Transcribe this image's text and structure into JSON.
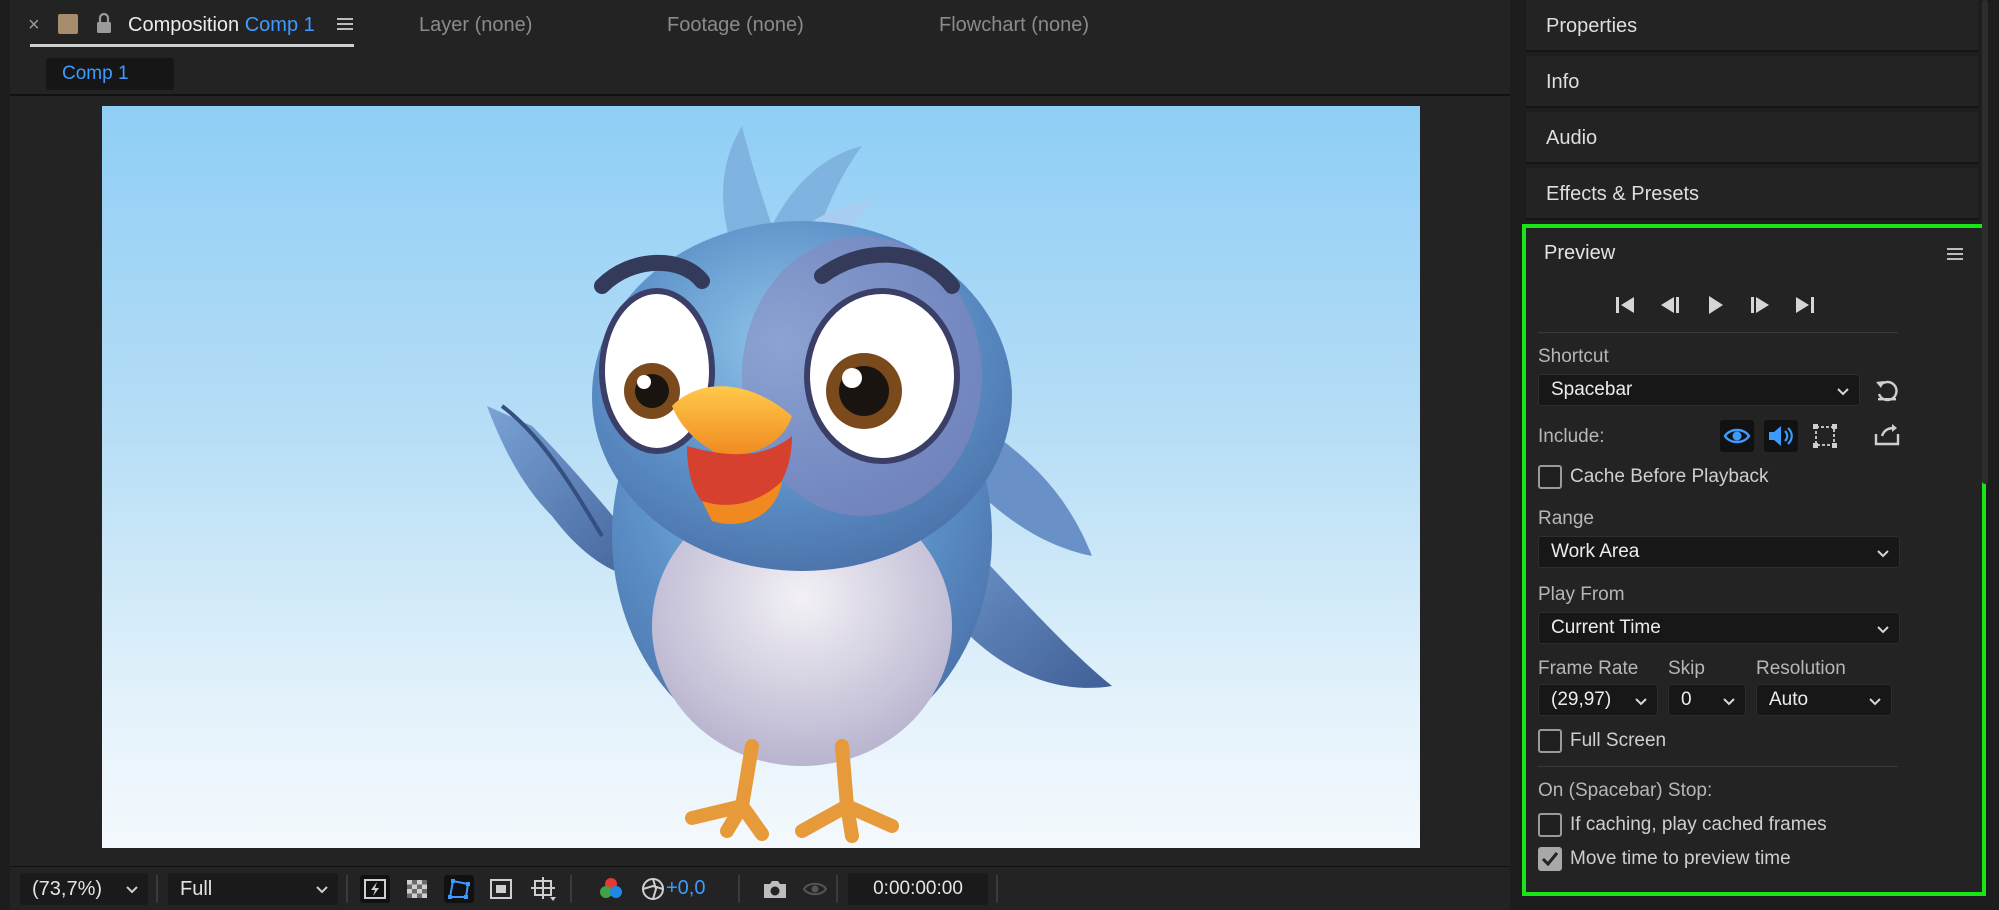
{
  "composition_tab": {
    "close_glyph": "×",
    "title_prefix": "Composition",
    "title_name": "Comp 1",
    "swatch_color": "#a78d6d"
  },
  "other_tabs": [
    {
      "label": "Layer (none)"
    },
    {
      "label": "Footage (none)"
    },
    {
      "label": "Flowchart (none)"
    }
  ],
  "subtab": {
    "label": "Comp 1"
  },
  "viewer_toolbar": {
    "magnification": "(73,7%)",
    "resolution": "Full",
    "exposure": "+0,0",
    "timecode": "0:00:00:00"
  },
  "right_panels": {
    "properties": "Properties",
    "info": "Info",
    "audio": "Audio",
    "effects_presets": "Effects & Presets"
  },
  "preview": {
    "title": "Preview",
    "shortcut_label": "Shortcut",
    "shortcut_value": "Spacebar",
    "include_label": "Include:",
    "cache_before_playback": {
      "label": "Cache Before Playback",
      "checked": false
    },
    "range_label": "Range",
    "range_value": "Work Area",
    "play_from_label": "Play From",
    "play_from_value": "Current Time",
    "frame_rate_label": "Frame Rate",
    "frame_rate_value": "(29,97)",
    "skip_label": "Skip",
    "skip_value": "0",
    "resolution_label": "Resolution",
    "resolution_value": "Auto",
    "full_screen": {
      "label": "Full Screen",
      "checked": false
    },
    "stop_label": "On (Spacebar) Stop:",
    "if_caching": {
      "label": "If caching, play cached frames",
      "checked": false
    },
    "move_time": {
      "label": "Move time to preview time",
      "checked": true
    }
  },
  "colors": {
    "accent_blue": "#3d9bff",
    "highlight_green": "#19e519"
  }
}
